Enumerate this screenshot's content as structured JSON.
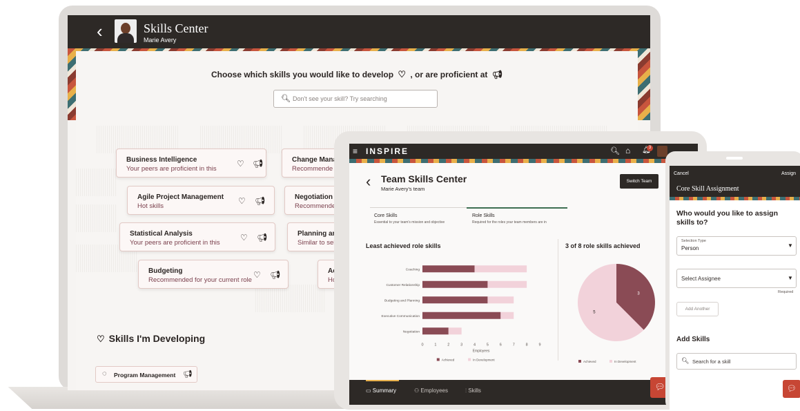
{
  "laptop": {
    "title": "Skills Center",
    "subtitle": "Marie Avery",
    "prompt_part1": "Choose which skills you would like to develop",
    "prompt_part2": ", or are proficient at",
    "search_placeholder": "Don't see your skill? Try searching",
    "cards": [
      {
        "title": "Business Intelligence",
        "subtitle": "Your peers are proficient in this"
      },
      {
        "title": "Change Mana",
        "subtitle": "Recommende"
      },
      {
        "title": "Agile Project Management",
        "subtitle": "Hot skills"
      },
      {
        "title": "Negotiation",
        "subtitle": "Recommende"
      },
      {
        "title": "Statistical Analysis",
        "subtitle": "Your peers are proficient in this"
      },
      {
        "title": "Planning and",
        "subtitle": "Similar to sele"
      },
      {
        "title": "Budgeting",
        "subtitle": "Recommended for your current role"
      },
      {
        "title": "Ac",
        "subtitle": "Hc"
      }
    ],
    "developing_heading": "Skills I'm Developing",
    "developing_chip": "Program Management"
  },
  "tablet": {
    "brand": "INSPIRE",
    "notification_count": "3",
    "title": "Team Skills Center",
    "subtitle": "Marie Avery's team",
    "switch_button": "Switch Team",
    "tabs": [
      {
        "label": "Core Skills",
        "desc": "Essential to your team's mission and objective"
      },
      {
        "label": "Role Skills",
        "desc": "Required for the roles your team members are in"
      }
    ],
    "bar_title": "Least achieved role skills",
    "pie_title": "3 of 8 role skills achieved",
    "legend_achieved": "Achieved",
    "legend_dev": "In Development",
    "bottom_nav": [
      "Summary",
      "Employees",
      "Skills"
    ]
  },
  "chart_data": [
    {
      "type": "bar",
      "title": "Least achieved role skills",
      "categories": [
        "Coaching",
        "Customer Relationship",
        "Budgeting and Planning",
        "Executive Communication",
        "Negotiation"
      ],
      "series": [
        {
          "name": "Achieved",
          "values": [
            4,
            5,
            5,
            6,
            2
          ]
        },
        {
          "name": "In Development",
          "values": [
            4,
            3,
            2,
            1,
            1
          ]
        }
      ],
      "xlabel": "Employees",
      "xticks": [
        "0",
        "1",
        "2",
        "3",
        "4",
        "5",
        "6",
        "7",
        "8",
        "9"
      ],
      "xlim": [
        0,
        9
      ],
      "legend": "bottom",
      "colors": {
        "achieved": "#8a4b55",
        "dev": "#f2d2da"
      }
    },
    {
      "type": "pie",
      "title": "3 of 8 role skills achieved",
      "slices": [
        {
          "name": "Achieved",
          "value": 3
        },
        {
          "name": "In Development",
          "value": 5
        }
      ],
      "legend": "bottom",
      "colors": {
        "achieved": "#8a4b55",
        "dev": "#f2d2da"
      }
    }
  ],
  "phone": {
    "cancel": "Cancel",
    "assign": "Assign",
    "title": "Core Skill Assignment",
    "question": "Who would you like to assign skills to?",
    "selection_type_label": "Selection Type",
    "selection_type_value": "Person",
    "assignee_placeholder": "Select Assignee",
    "required": "Required",
    "add_another": "Add Another",
    "add_skills_heading": "Add Skills",
    "search_placeholder": "Search for a skill"
  },
  "colors": {
    "dark": "#2d2926",
    "accent": "#c74634",
    "mauve": "#8a4b55",
    "pink": "#f2d2da"
  }
}
